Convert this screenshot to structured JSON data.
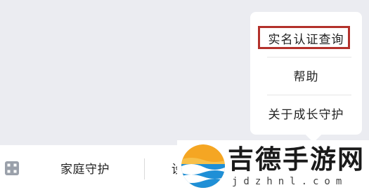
{
  "popup_menu": {
    "items": [
      {
        "label": "实名认证查询",
        "highlighted": true
      },
      {
        "label": "帮助"
      },
      {
        "label": "关于成长守护"
      }
    ],
    "highlight_color": "#b3312b"
  },
  "bottom_bar": {
    "menu_icon": "grid-menu-icon",
    "tabs": [
      {
        "label": "家庭守护"
      },
      {
        "label": "设"
      }
    ]
  },
  "watermark": {
    "title": "吉德手游网",
    "url": "jdzhnl.com"
  },
  "colors": {
    "content_background": "#ebecf1",
    "menu_background": "#ffffff",
    "text": "#222222"
  }
}
